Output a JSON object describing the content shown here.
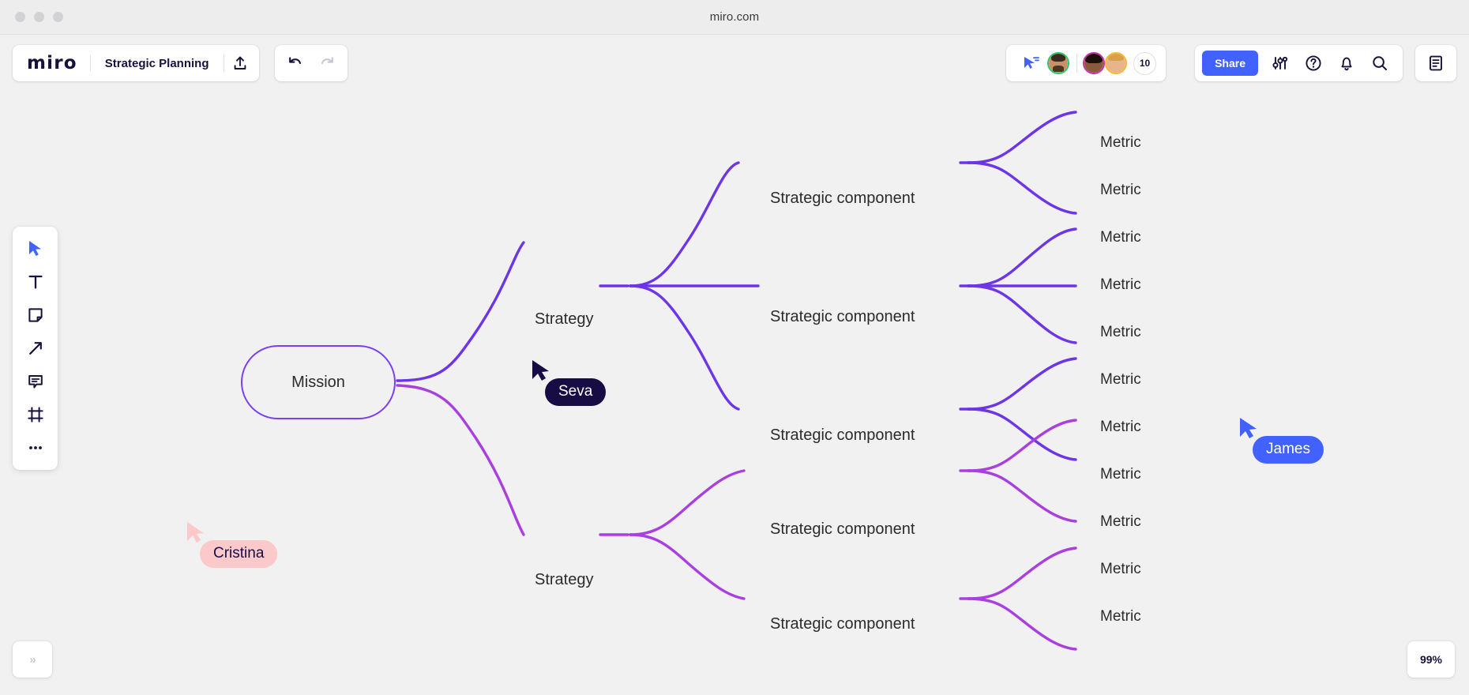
{
  "browser": {
    "url_title": "miro.com",
    "traffic_lights": [
      "close-dot",
      "minimize-dot",
      "maximize-dot"
    ]
  },
  "header": {
    "logo": "miro",
    "board_name": "Strategic Planning",
    "upload_icon": "upload-icon",
    "undo_icon": "undo-icon",
    "redo_icon": "redo-icon",
    "cursor_share_icon": "cursor-share-icon",
    "collaborator_count": "10",
    "share_label": "Share",
    "settings_icon": "sliders-icon",
    "help_icon": "question-circle-icon",
    "notifications_icon": "bell-icon",
    "search_icon": "search-icon",
    "notes_icon": "notes-panel-icon",
    "avatars": [
      {
        "name": "avatar-1",
        "ring": "#2fc56d",
        "skin": "#c98f66",
        "hair": "#3a2a1d"
      },
      {
        "name": "avatar-2",
        "ring": "#c231a8",
        "skin": "#8a5a3c",
        "hair": "#1d1008"
      },
      {
        "name": "avatar-3",
        "ring": "#f5b731",
        "skin": "#e8b48c",
        "hair": "#d9a04a"
      }
    ]
  },
  "toolbar": {
    "items": [
      {
        "icon": "select-cursor-icon",
        "label": "Select"
      },
      {
        "icon": "text-icon",
        "label": "Text"
      },
      {
        "icon": "sticky-note-icon",
        "label": "Sticky note"
      },
      {
        "icon": "arrow-connector-icon",
        "label": "Connection line"
      },
      {
        "icon": "comment-icon",
        "label": "Comment"
      },
      {
        "icon": "frame-icon",
        "label": "Frame"
      },
      {
        "icon": "more-tools-icon",
        "label": "More tools"
      }
    ]
  },
  "mindmap": {
    "root": "Mission",
    "branches": [
      {
        "strategy": "Strategy",
        "color": "#6c35e8",
        "components": [
          {
            "label": "Strategic component",
            "metrics": [
              "Metric",
              "Metric"
            ]
          },
          {
            "label": "Strategic component",
            "metrics": [
              "Metric",
              "Metric",
              "Metric"
            ]
          },
          {
            "label": "Strategic component",
            "metrics": [
              "Metric",
              "Metric"
            ]
          }
        ]
      },
      {
        "strategy": "Strategy",
        "color": "#a93fe0",
        "components": [
          {
            "label": "Strategic component",
            "metrics": [
              "Metric",
              "Metric"
            ]
          },
          {
            "label": "Strategic component",
            "metrics": [
              "Metric",
              "Metric"
            ]
          }
        ]
      }
    ]
  },
  "cursors": [
    {
      "name": "Seva",
      "pill_bg": "#170c43",
      "pill_fg": "#ffffff",
      "pointer": "#170c43"
    },
    {
      "name": "James",
      "pill_bg": "#4262ff",
      "pill_fg": "#ffffff",
      "pointer": "#4262ff"
    },
    {
      "name": "Cristina",
      "pill_bg": "#fbc9c9",
      "pill_fg": "#170c43",
      "pointer": "#fbc9c9"
    }
  ],
  "footer": {
    "expand_label": "»",
    "zoom_level": "99%"
  },
  "colors": {
    "accent_blue": "#4262ff",
    "brand_dark": "#18113c",
    "branch_purple": "#6c35e8",
    "branch_magenta": "#a93fe0",
    "canvas_bg": "#f1f1f1"
  }
}
